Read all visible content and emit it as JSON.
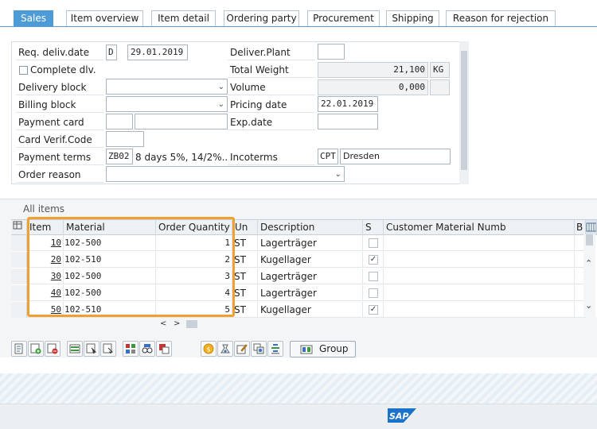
{
  "tabs": [
    {
      "label": "Sales",
      "active": true
    },
    {
      "label": "Item overview"
    },
    {
      "label": "Item detail"
    },
    {
      "label": "Ordering party"
    },
    {
      "label": "Procurement"
    },
    {
      "label": "Shipping"
    },
    {
      "label": "Reason for rejection"
    }
  ],
  "form": {
    "req_deliv_date_label": "Req. deliv.date",
    "req_deliv_date_unit": "D",
    "req_deliv_date_value": "29.01.2019",
    "deliver_plant_label": "Deliver.Plant",
    "deliver_plant_value": "",
    "complete_dlv_label": "Complete dlv.",
    "total_weight_label": "Total Weight",
    "total_weight_value": "21,100",
    "total_weight_unit": "KG",
    "delivery_block_label": "Delivery block",
    "volume_label": "Volume",
    "volume_value": "0,000",
    "billing_block_label": "Billing block",
    "pricing_date_label": "Pricing date",
    "pricing_date_value": "22.01.2019",
    "payment_card_label": "Payment card",
    "exp_date_label": "Exp.date",
    "card_verif_label": "Card Verif.Code",
    "payment_terms_label": "Payment terms",
    "payment_terms_code": "ZB02",
    "payment_terms_text": "8 days 5%, 14/2%...",
    "incoterms_label": "Incoterms",
    "incoterms_code": "CPT",
    "incoterms_place": "Dresden",
    "order_reason_label": "Order reason"
  },
  "items_table": {
    "title": "All items",
    "columns": [
      "Item",
      "Material",
      "Order Quantity",
      "Un",
      "Description",
      "S",
      "Customer Material Numb",
      "B"
    ],
    "rows": [
      {
        "item": "10",
        "material": "102-500",
        "qty": "1",
        "unit": "ST",
        "description": "Lagerträger",
        "checked": false
      },
      {
        "item": "20",
        "material": "102-510",
        "qty": "2",
        "unit": "ST",
        "description": "Kugellager",
        "checked": true
      },
      {
        "item": "30",
        "material": "102-500",
        "qty": "3",
        "unit": "ST",
        "description": "Lagerträger",
        "checked": false
      },
      {
        "item": "40",
        "material": "102-500",
        "qty": "4",
        "unit": "ST",
        "description": "Lagerträger",
        "checked": false
      },
      {
        "item": "50",
        "material": "102-510",
        "qty": "5",
        "unit": "ST",
        "description": "Kugellager",
        "checked": true
      }
    ]
  },
  "toolbar": {
    "group_label": "Group"
  },
  "footer": {
    "logo_text": "SAP"
  },
  "colors": {
    "tab_active": "#4d9cd8",
    "highlight": "#f0a030",
    "sap_logo": "#1a73c9"
  }
}
